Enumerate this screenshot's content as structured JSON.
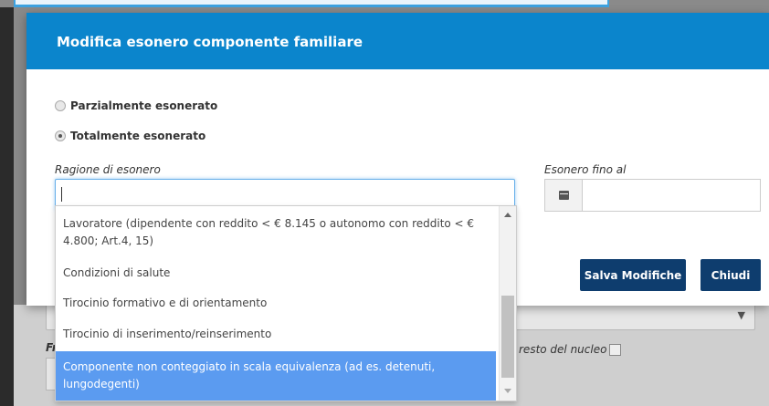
{
  "background": {
    "label_fr": "Fr",
    "label_resto": "resto del nucleo"
  },
  "modal": {
    "title": "Modifica esonero componente familiare",
    "radios": [
      {
        "label": "Parzialmente esonerato",
        "checked": false
      },
      {
        "label": "Totalmente esonerato",
        "checked": true
      }
    ],
    "reason_label": "Ragione di esonero",
    "reason_value": "",
    "date_label": "Esonero fino al",
    "date_value": "",
    "save_label": "Salva Modifiche",
    "close_label": "Chiudi"
  },
  "dropdown": {
    "options": [
      "Lavoratore (dipendente con reddito < € 8.145 o autonomo con reddito < € 4.800; Art.4, 15)",
      "Condizioni di salute",
      "Tirocinio formativo e di orientamento",
      "Tirocinio di inserimento/reinserimento",
      "Componente non conteggiato in scala equivalenza (ad es. detenuti, lungodegenti)"
    ],
    "selected_index": 4
  },
  "icons": {
    "calendar": "calendar-icon",
    "scroll_up": "scroll-up-arrow-icon",
    "scroll_down": "scroll-down-arrow-icon",
    "select_arrow": "chevron-down-icon"
  },
  "colors": {
    "header": "#0b85cc",
    "button": "#0e3d6e",
    "selected_option": "#5b9bf0"
  }
}
